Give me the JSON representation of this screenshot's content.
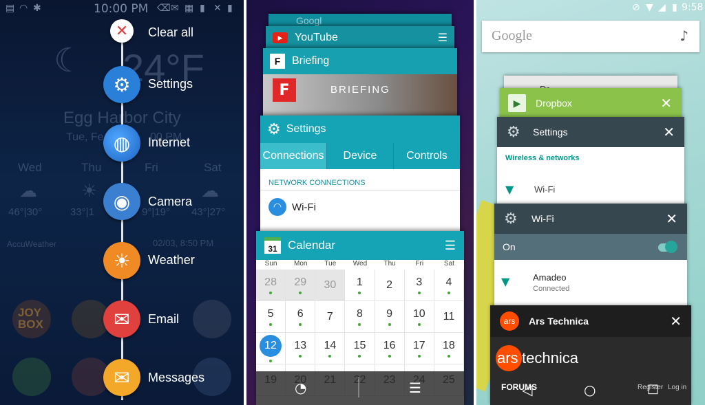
{
  "panel1": {
    "status_time": "10:00 PM",
    "bg": {
      "temp": "24°F",
      "city": "Egg Harbor City",
      "date": "Tue, Fe",
      "time_tail": "00 PM",
      "days": [
        "Wed",
        "Thu",
        "Fri",
        "Sat"
      ],
      "temps": [
        "46°|30°",
        "33°|1",
        "9°|19°",
        "43°|27°"
      ],
      "provider": "AccuWeather",
      "updated": "02/03, 8:50 PM",
      "joy": "JOY",
      "box": "BOX"
    },
    "menu": [
      {
        "label": "Clear all",
        "icon": "close-icon",
        "color": "#ffffff"
      },
      {
        "label": "Settings",
        "icon": "gear-icon",
        "color": "#2a7fd8"
      },
      {
        "label": "Internet",
        "icon": "globe-icon",
        "color": "#2a7fd8"
      },
      {
        "label": "Camera",
        "icon": "camera-icon",
        "color": "#3a7fd0"
      },
      {
        "label": "Weather",
        "icon": "sun-icon",
        "color": "#f08a24"
      },
      {
        "label": "Email",
        "icon": "email-icon",
        "color": "#e0403e"
      },
      {
        "label": "Messages",
        "icon": "message-icon",
        "color": "#f3a82a"
      }
    ]
  },
  "panel2": {
    "cards": {
      "top_partial": "Googl",
      "youtube": "YouTube",
      "briefing": "Briefing",
      "briefing_banner": "BRIEFING",
      "settings": "Settings",
      "settings_tabs": [
        "Connections",
        "Device",
        "Controls"
      ],
      "settings_section": "NETWORK CONNECTIONS",
      "settings_wifi": "Wi-Fi",
      "calendar": "Calendar",
      "calendar_icon_num": "31"
    },
    "calendar": {
      "weekdays": [
        "Sun",
        "Mon",
        "Tue",
        "Wed",
        "Thu",
        "Fri",
        "Sat"
      ],
      "weeks": [
        [
          {
            "d": "28",
            "g": true,
            "dot": true
          },
          {
            "d": "29",
            "g": true,
            "dot": true
          },
          {
            "d": "30",
            "g": true,
            "dot": false
          },
          {
            "d": "1",
            "g": false,
            "dot": true
          },
          {
            "d": "2",
            "g": false,
            "dot": false
          },
          {
            "d": "3",
            "g": false,
            "dot": true
          },
          {
            "d": "4",
            "g": false,
            "dot": true
          }
        ],
        [
          {
            "d": "5",
            "g": false,
            "dot": true
          },
          {
            "d": "6",
            "g": false,
            "dot": true
          },
          {
            "d": "7",
            "g": false,
            "dot": false
          },
          {
            "d": "8",
            "g": false,
            "dot": true
          },
          {
            "d": "9",
            "g": false,
            "dot": true
          },
          {
            "d": "10",
            "g": false,
            "dot": true
          },
          {
            "d": "11",
            "g": false,
            "dot": false
          }
        ],
        [
          {
            "d": "12",
            "g": false,
            "dot": true,
            "today": true
          },
          {
            "d": "13",
            "g": false,
            "dot": true
          },
          {
            "d": "14",
            "g": false,
            "dot": true
          },
          {
            "d": "15",
            "g": false,
            "dot": true
          },
          {
            "d": "16",
            "g": false,
            "dot": true
          },
          {
            "d": "17",
            "g": false,
            "dot": true
          },
          {
            "d": "18",
            "g": false,
            "dot": true
          }
        ],
        [
          {
            "d": "19",
            "g": false,
            "dot": false
          },
          {
            "d": "20",
            "g": false,
            "dot": false
          },
          {
            "d": "21",
            "g": false,
            "dot": false
          },
          {
            "d": "22",
            "g": false,
            "dot": false
          },
          {
            "d": "23",
            "g": false,
            "dot": false
          },
          {
            "d": "24",
            "g": false,
            "dot": false
          },
          {
            "d": "25",
            "g": false,
            "dot": false
          }
        ]
      ]
    }
  },
  "panel3": {
    "status_time": "9:58",
    "search_placeholder": "Google",
    "cards": {
      "drop_partial": "Dr",
      "dropbox": "Dropbox",
      "settings": "Settings",
      "wireless": "Wireless & networks",
      "wifi_item": "Wi-Fi",
      "wifi": "Wi-Fi",
      "on": "On",
      "network_name": "Amadeo",
      "network_status": "Connected",
      "ars": "Ars Technica",
      "ars_icon": "ars",
      "ars_logo_a": "ars",
      "ars_logo_b": "technica",
      "forums": "FORUMS",
      "register": "Register",
      "login": "Log in"
    }
  }
}
